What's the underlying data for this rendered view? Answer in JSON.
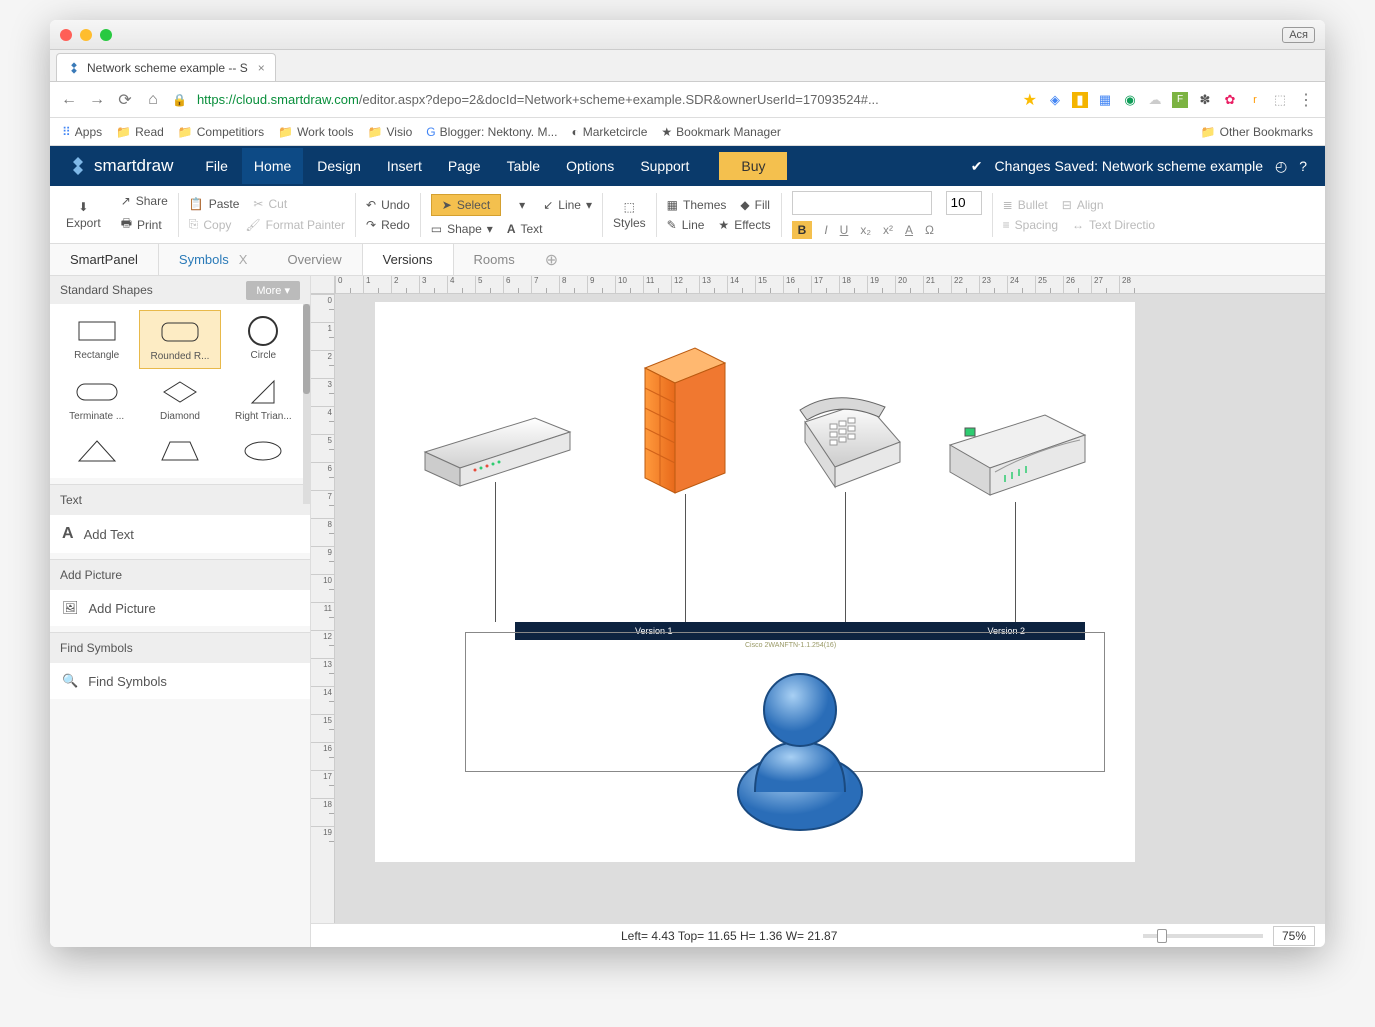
{
  "browser": {
    "profile": "Ася",
    "tab_title": "Network scheme example -- S",
    "url_prefix": "https://",
    "url_host": "cloud.smartdraw.com",
    "url_path": "/editor.aspx?depo=2&docId=Network+scheme+example.SDR&ownerUserId=17093524#...",
    "bookmarks": [
      "Apps",
      "Read",
      "Competitiors",
      "Work tools",
      "Visio",
      "Blogger: Nektony. M...",
      "Marketcircle",
      "Bookmark Manager"
    ],
    "other_bookmarks": "Other Bookmarks"
  },
  "app": {
    "brand": "smartdraw",
    "menus": [
      "File",
      "Home",
      "Design",
      "Insert",
      "Page",
      "Table",
      "Options",
      "Support"
    ],
    "active_menu": "Home",
    "buy": "Buy",
    "save_status": "Changes Saved: Network scheme example"
  },
  "ribbon": {
    "export": "Export",
    "share": "Share",
    "print": "Print",
    "paste": "Paste",
    "cut": "Cut",
    "copy": "Copy",
    "format_painter": "Format Painter",
    "undo": "Undo",
    "redo": "Redo",
    "select": "Select",
    "line": "Line",
    "shape": "Shape",
    "text": "Text",
    "styles": "Styles",
    "themes": "Themes",
    "fill": "Fill",
    "line2": "Line",
    "effects": "Effects",
    "font_size": "10",
    "bullet": "Bullet",
    "align": "Align",
    "spacing": "Spacing",
    "textdir": "Text Directio"
  },
  "panel_tabs": {
    "smart": "SmartPanel",
    "symbols": "Symbols",
    "overview": "Overview",
    "versions": "Versions",
    "rooms": "Rooms"
  },
  "side": {
    "shapes_title": "Standard Shapes",
    "more": "More",
    "shape_labels": [
      "Rectangle",
      "Rounded R...",
      "Circle",
      "Terminate ...",
      "Diamond",
      "Right Trian..."
    ],
    "text": "Text",
    "add_text": "Add Text",
    "picture": "Add Picture",
    "add_picture": "Add Picture",
    "find": "Find Symbols",
    "find_symbols": "Find Symbols"
  },
  "diagram": {
    "version1": "Version 1",
    "version2": "Version 2",
    "cisco": "Cisco 2WANFTN-1.1.254(16)"
  },
  "status": {
    "coords": "Left= 4.43 Top= 11.65 H= 1.36 W= 21.87",
    "zoom": "75%"
  }
}
